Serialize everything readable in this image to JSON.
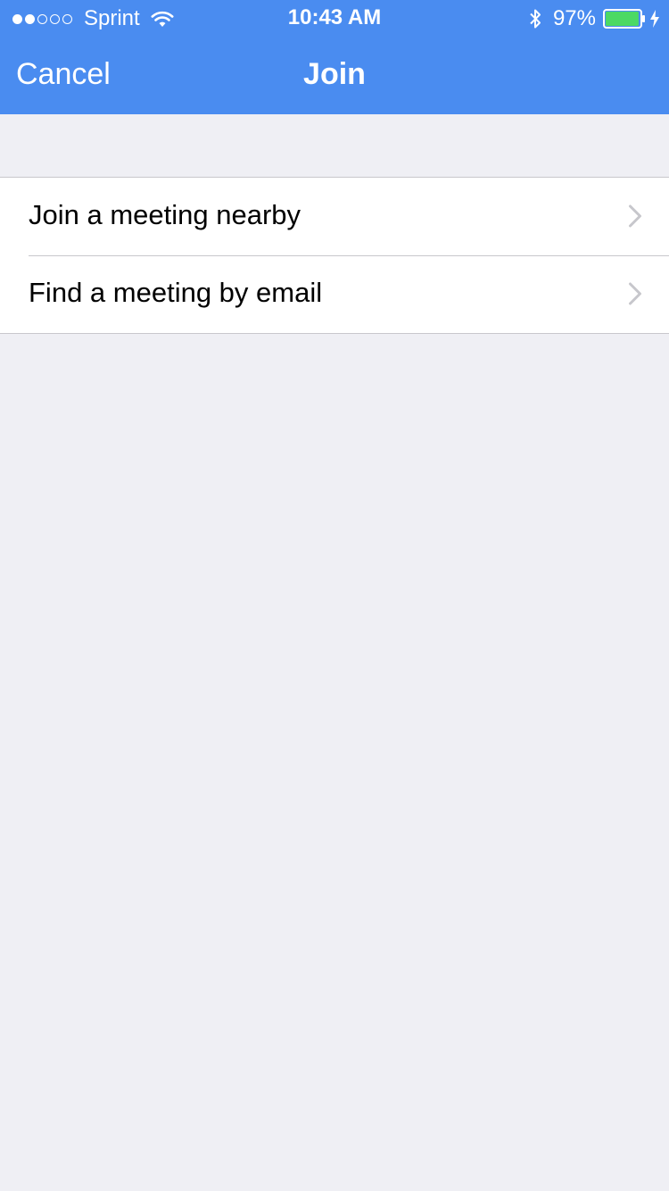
{
  "status_bar": {
    "signal_dots": [
      true,
      true,
      false,
      false,
      false
    ],
    "carrier": "Sprint",
    "time": "10:43 AM",
    "battery_percent": "97%",
    "icons": [
      "wifi-icon",
      "bluetooth-icon",
      "battery-icon",
      "charging-bolt-icon"
    ],
    "battery_level": 0.97,
    "battery_color": "#4cd964"
  },
  "nav": {
    "cancel_label": "Cancel",
    "title": "Join"
  },
  "list": {
    "items": [
      {
        "label": "Join a meeting nearby",
        "icon": "chevron-right-icon"
      },
      {
        "label": "Find a meeting by email",
        "icon": "chevron-right-icon"
      }
    ]
  },
  "colors": {
    "nav_background": "#4a8cf0",
    "page_background": "#efeff4",
    "separator": "#c8c7cc",
    "chevron": "#c7c7cc"
  }
}
